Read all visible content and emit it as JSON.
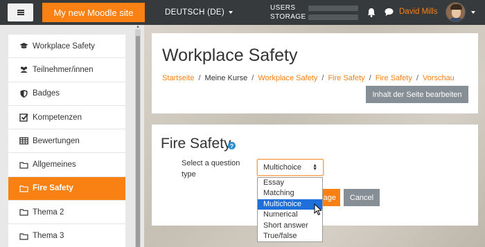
{
  "navbar": {
    "site_name": "My new Moodle site",
    "language": "DEUTSCH (DE)",
    "usage": {
      "users_label": "USERS",
      "storage_label": "STORAGE",
      "users_fraction": 0.0,
      "storage_fraction": 0.0
    },
    "user_name": "David Mills",
    "icons": [
      "menu-icon",
      "bell-icon",
      "chat-icon",
      "avatar",
      "caret-down-icon"
    ]
  },
  "drawer": {
    "items": [
      {
        "label": "Workplace Safety",
        "icon": "graduation-cap-icon"
      },
      {
        "label": "Teilnehmer/innen",
        "icon": "users-icon"
      },
      {
        "label": "Badges",
        "icon": "shield-icon"
      },
      {
        "label": "Kompetenzen",
        "icon": "checkbox-icon"
      },
      {
        "label": "Bewertungen",
        "icon": "table-icon"
      },
      {
        "label": "Allgemeines",
        "icon": "folder-icon"
      },
      {
        "label": "Fire Safety",
        "icon": "folder-icon",
        "active": true
      },
      {
        "label": "Thema 2",
        "icon": "folder-icon"
      },
      {
        "label": "Thema 3",
        "icon": "folder-icon"
      }
    ]
  },
  "header": {
    "title": "Workplace Safety",
    "breadcrumb": [
      "Startseite",
      "Meine Kurse",
      "Workplace Safety",
      "Fire Safety",
      "Fire Safety",
      "Vorschau"
    ],
    "edit_button": "Inhalt der Seite bearbeiten"
  },
  "main": {
    "section_title": "Fire Safety",
    "help_glyph": "?",
    "select_label": "Select a question type",
    "select_value": "Multichoice",
    "add_button_visible": "age",
    "cancel_button": "Cancel",
    "options": [
      "Essay",
      "Matching",
      "Multichoice",
      "Numerical",
      "Short answer",
      "True/false"
    ],
    "highlighted_option": "Multichoice"
  },
  "colors": {
    "accent": "#f98012",
    "navbar": "#373a3c",
    "secondary_button": "#868e96",
    "highlight": "#1e6fd9"
  }
}
